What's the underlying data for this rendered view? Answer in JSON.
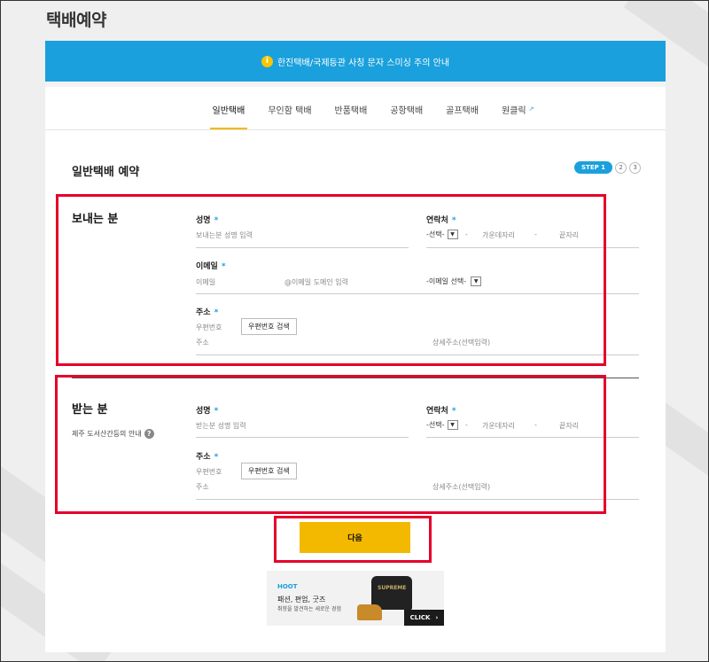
{
  "page": {
    "title": "택배예약"
  },
  "notice": {
    "icon": "i",
    "text": "한진택배/국제등관 사칭 문자 스미싱 주의 안내"
  },
  "tabs": [
    {
      "label": "일반택배"
    },
    {
      "label": "무인함 택배"
    },
    {
      "label": "반품택배"
    },
    {
      "label": "공항택배"
    },
    {
      "label": "골프택배"
    },
    {
      "label": "원클릭",
      "ext_icon": "↗"
    }
  ],
  "section": {
    "title": "일반택배 예약"
  },
  "steps": {
    "step1": "STEP 1",
    "step2": "2",
    "step3": "3"
  },
  "sender": {
    "title": "보내는 분",
    "name_label": "성명",
    "name_placeholder": "보내는분 성명 입력",
    "phone_label": "연락처",
    "phone_select": "-선택-",
    "phone_mid": "가운데자리",
    "phone_last": "끝자리",
    "email_label": "이메일",
    "email_placeholder": "이메일",
    "email_domain": "@이메일 도메인 입력",
    "email_select": "-이메일 선택-",
    "address_label": "주소",
    "zip_placeholder": "우편번호",
    "zip_button": "우편번호 검색",
    "addr_placeholder": "주소",
    "addr_detail": "상세주소(선택입력)"
  },
  "receiver": {
    "title": "받는 분",
    "sub": "제주 도서산간등의 안내",
    "name_label": "성명",
    "name_placeholder": "받는분 성명 입력",
    "phone_label": "연락처",
    "phone_select": "-선택-",
    "phone_mid": "가운데자리",
    "phone_last": "끝자리",
    "address_label": "주소",
    "zip_placeholder": "우편번호",
    "zip_button": "우편번호 검색",
    "addr_placeholder": "주소",
    "addr_detail": "상세주소(선택입력)"
  },
  "common": {
    "required_mark": "*",
    "dash": "-",
    "select_arrow": "▼",
    "help_icon": "?"
  },
  "next_button": "다음",
  "ad": {
    "brand": "HOOT",
    "line1": "패션, 편엄, 굿즈",
    "line2": "취향을 발견하는 새로운 경험",
    "shirt_text": "SUPREME",
    "cta": "CLICK",
    "cta_arrow": "›"
  },
  "colors": {
    "accent": "#1aa0dc",
    "button": "#f3b900",
    "highlight": "#e5002c"
  }
}
